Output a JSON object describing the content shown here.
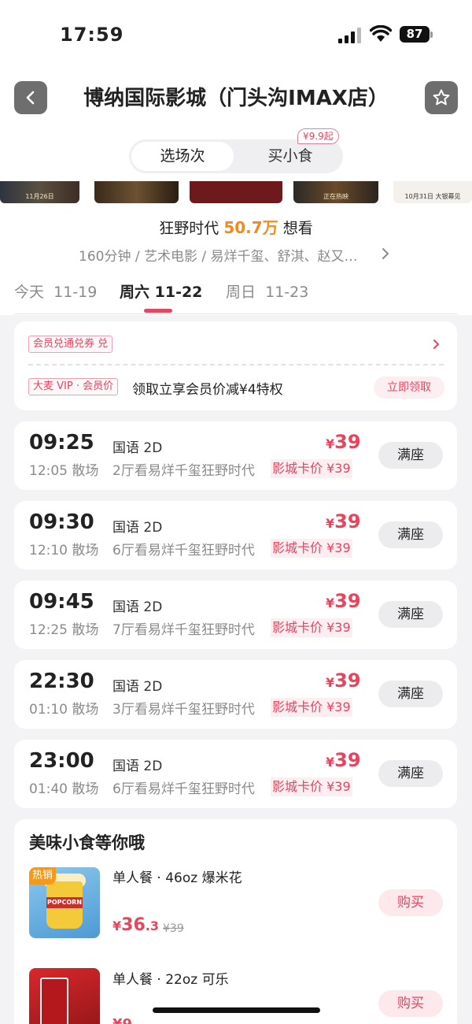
{
  "status": {
    "time": "17:59",
    "battery": "87"
  },
  "header": {
    "title": "博纳国际影城（门头沟IMAX店）"
  },
  "tabs": {
    "active": "选场次",
    "other": "买小食",
    "snack_tag": "¥9.9起"
  },
  "movie": {
    "name": "狂野时代",
    "want_count": "50.7万",
    "want_label": "想看",
    "meta": "160分钟 / 艺术电影 / 易烊千玺、舒淇、赵又…",
    "poster_captions": [
      "11月26日",
      "",
      "",
      "正在热映",
      "10月31日 大银幕见"
    ]
  },
  "dates": [
    {
      "day": "今天",
      "date": "11-19"
    },
    {
      "day": "周六",
      "date": "11-22"
    },
    {
      "day": "周日",
      "date": "11-23"
    }
  ],
  "coupon": {
    "tag1": "会员兑通兑券 兑",
    "tag2": "大麦 VIP · 会员价",
    "text": "领取立享会员价减¥4特权",
    "button": "立即领取"
  },
  "showtimes": [
    {
      "start": "09:25",
      "end": "12:05 散场",
      "lang": "国语 2D",
      "hall": "2厅看易烊千玺狂野时代",
      "currency": "¥",
      "price": "39",
      "card_price": "影城卡价 ¥39",
      "status": "满座"
    },
    {
      "start": "09:30",
      "end": "12:10 散场",
      "lang": "国语 2D",
      "hall": "6厅看易烊千玺狂野时代",
      "currency": "¥",
      "price": "39",
      "card_price": "影城卡价 ¥39",
      "status": "满座"
    },
    {
      "start": "09:45",
      "end": "12:25 散场",
      "lang": "国语 2D",
      "hall": "7厅看易烊千玺狂野时代",
      "currency": "¥",
      "price": "39",
      "card_price": "影城卡价 ¥39",
      "status": "满座"
    },
    {
      "start": "22:30",
      "end": "01:10 散场",
      "lang": "国语 2D",
      "hall": "3厅看易烊千玺狂野时代",
      "currency": "¥",
      "price": "39",
      "card_price": "影城卡价 ¥39",
      "status": "满座"
    },
    {
      "start": "23:00",
      "end": "01:40 散场",
      "lang": "国语 2D",
      "hall": "6厅看易烊千玺狂野时代",
      "currency": "¥",
      "price": "39",
      "card_price": "影城卡价 ¥39",
      "status": "满座"
    }
  ],
  "snacks": {
    "title": "美味小食等你哦",
    "items": [
      {
        "badge": "热销",
        "image_text": "POPCORN",
        "name": "单人餐 · 46oz 爆米花",
        "currency": "¥",
        "price_int": "36",
        "price_dec": ".3",
        "old_price": "¥39",
        "button": "购买"
      },
      {
        "name": "单人餐 · 22oz 可乐",
        "price_partial": "¥9",
        "button": "购买"
      }
    ]
  },
  "colors": {
    "accent": "#e8445e",
    "want_orange": "#f08a21",
    "background": "#f3f3f5"
  }
}
